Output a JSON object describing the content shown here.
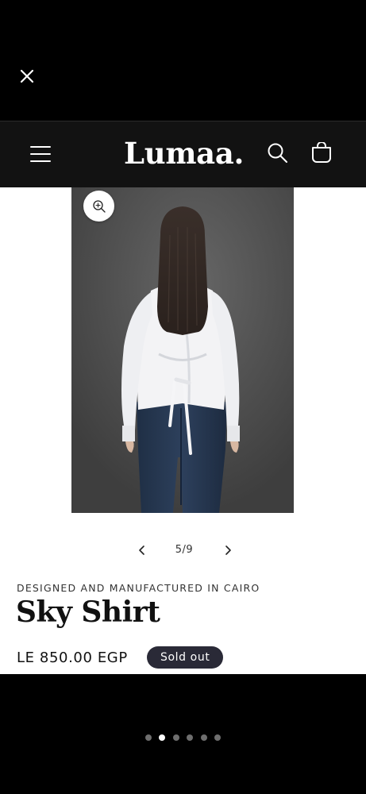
{
  "icons": {
    "close": "close-icon",
    "menu": "hamburger-menu-icon",
    "search": "search-icon",
    "cart": "cart-icon",
    "zoom": "zoom-icon",
    "prev": "chevron-left-icon",
    "next": "chevron-right-icon"
  },
  "header": {
    "logo": "Lumaa."
  },
  "gallery": {
    "counter": "5/9"
  },
  "product": {
    "vendor": "DESIGNED AND MANUFACTURED IN CAIRO",
    "title": "Sky Shirt",
    "price": "LE 850.00 EGP",
    "badge": "Sold out"
  },
  "pager": {
    "count": 6,
    "active_index": 1
  },
  "colors": {
    "header_bg": "#121212",
    "page_bg": "#ffffff",
    "badge_bg": "#2a2a37"
  }
}
